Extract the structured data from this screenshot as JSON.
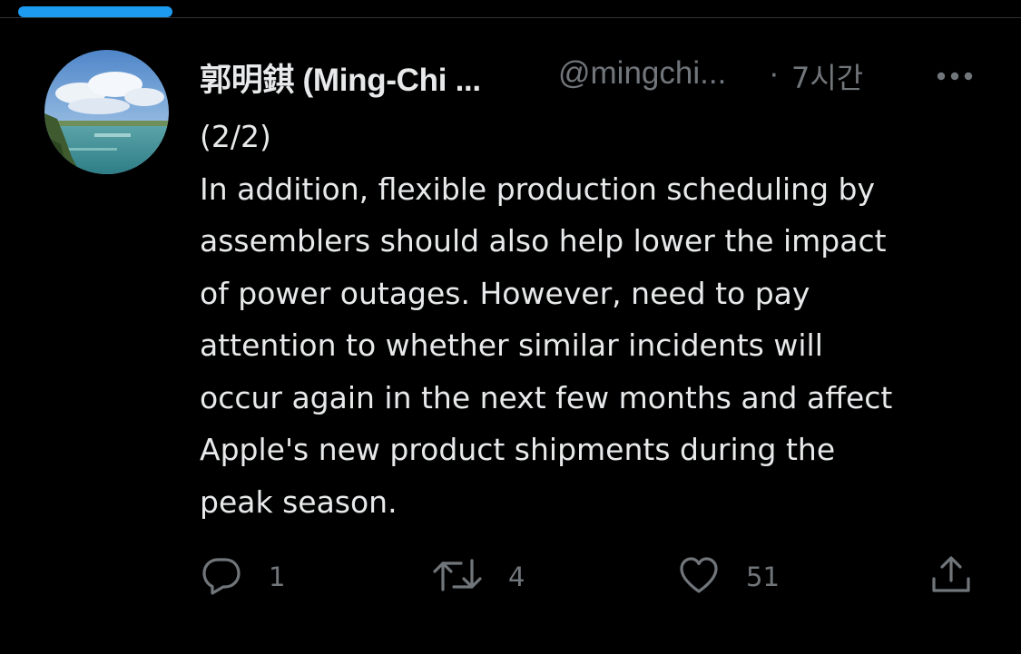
{
  "colors": {
    "background": "#000000",
    "text_primary": "#e7e9ea",
    "text_secondary": "#71767b",
    "accent": "#1d9bf0",
    "divider": "#2f3336"
  },
  "tweet": {
    "author_name": "郭明錤 (Ming-Chi ...",
    "author_handle": "@mingchi...",
    "separator": "·",
    "timestamp": "7시간",
    "more_icon": "more-horizontal-icon",
    "body_lines": [
      "(2/2)",
      "In addition, flexible production scheduling by",
      "assemblers should also help lower the impact",
      "of power outages. However, need to pay",
      "attention to whether similar incidents will",
      "occur again in the next few months and affect",
      "Apple's new product shipments during the",
      "peak season."
    ]
  },
  "actions": {
    "reply": {
      "icon": "reply-icon",
      "count": "1"
    },
    "retweet": {
      "icon": "retweet-icon",
      "count": "4"
    },
    "like": {
      "icon": "heart-icon",
      "count": "51"
    },
    "share": {
      "icon": "share-icon"
    }
  }
}
